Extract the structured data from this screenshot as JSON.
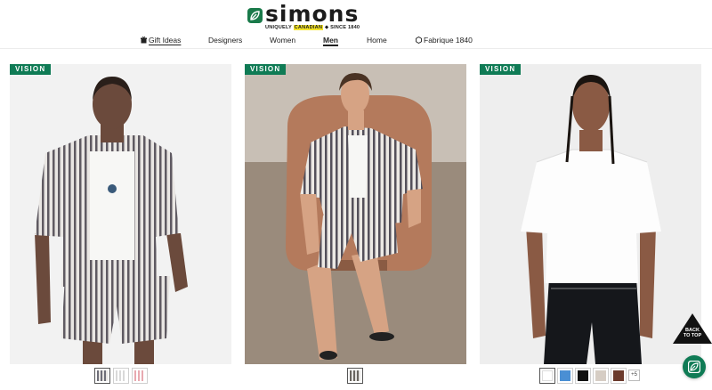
{
  "brand": {
    "name": "simons",
    "tagline_pre": "UNIQUELY ",
    "tagline_highlight": "CANADIAN",
    "tagline_post": " ◆ SINCE 1840"
  },
  "nav": {
    "gift_ideas": "Gift Ideas",
    "designers": "Designers",
    "women": "Women",
    "men": "Men",
    "home": "Home",
    "fabrique": "Fabrique 1840"
  },
  "products": [
    {
      "badge": "VISION",
      "swatch_colors": [
        "#6e6e78",
        "#d9d9d9",
        "#e8a9b0"
      ]
    },
    {
      "badge": "VISION",
      "swatch_colors": [
        "#6a6660"
      ]
    },
    {
      "badge": "VISION",
      "swatch_colors": [
        "#ffffff",
        "#4a8fd4",
        "#111111",
        "#d6cdc4",
        "#6b3a2c"
      ],
      "more_label": "+5"
    }
  ],
  "back_to_top": {
    "line1": "BACK",
    "line2": "TO TOP"
  },
  "colors": {
    "brand_green": "#0f7b55",
    "highlight": "#f5e52b"
  }
}
